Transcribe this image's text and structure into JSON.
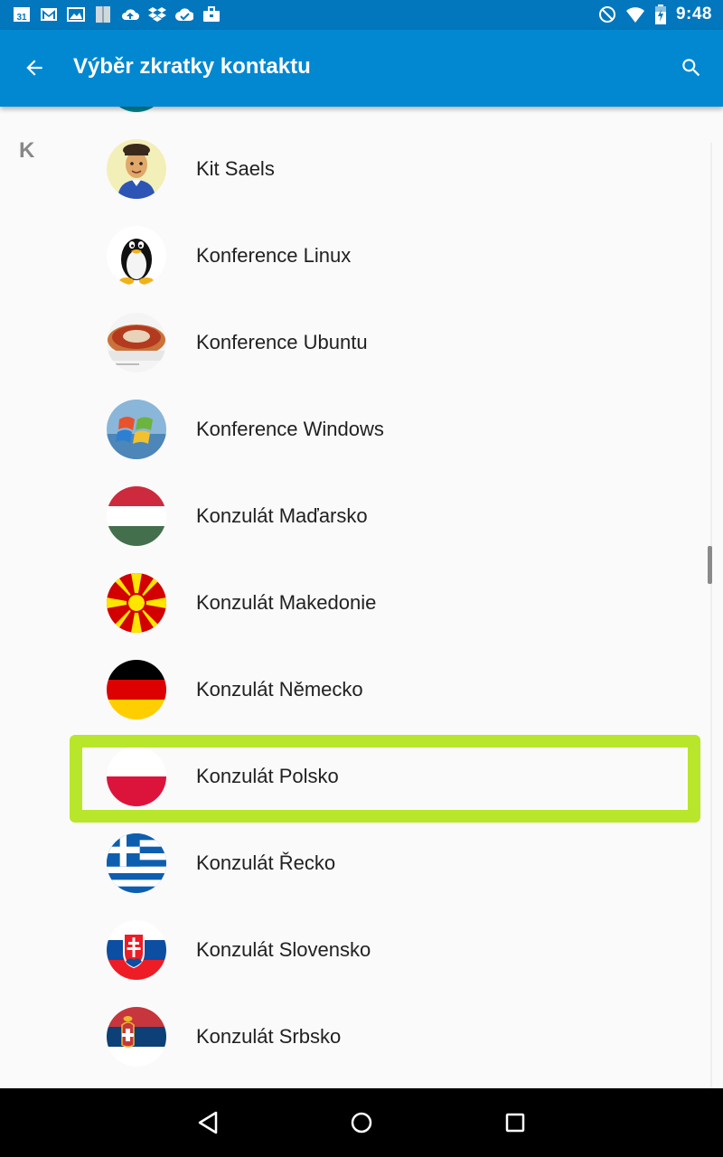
{
  "status_bar": {
    "time": "9:48",
    "calendar_day": "31",
    "left_icons": [
      "calendar-icon",
      "gmail-icon",
      "photos-icon",
      "book-icon",
      "cloud-upload-icon",
      "dropbox-icon",
      "check-cloud-icon",
      "briefcase-icon"
    ],
    "right_icons": [
      "do-not-disturb-icon",
      "wifi-icon",
      "battery-charging-icon"
    ]
  },
  "toolbar": {
    "title": "Výběr zkratky kontaktu",
    "back_icon": "arrow-back-icon",
    "search_icon": "search-icon",
    "color": "#0288d1"
  },
  "list": {
    "section_letter": "K",
    "contacts": [
      {
        "name": "Kit Saels",
        "avatar": "avatar-person"
      },
      {
        "name": "Konference Linux",
        "avatar": "avatar-tux"
      },
      {
        "name": "Konference Ubuntu",
        "avatar": "avatar-ubuntu"
      },
      {
        "name": "Konference Windows",
        "avatar": "avatar-windows"
      },
      {
        "name": "Konzulát Maďarsko",
        "avatar": "flag-hungary"
      },
      {
        "name": "Konzulát Makedonie",
        "avatar": "flag-macedonia"
      },
      {
        "name": "Konzulát Německo",
        "avatar": "flag-germany"
      },
      {
        "name": "Konzulát Polsko",
        "avatar": "flag-poland"
      },
      {
        "name": "Konzulát Řecko",
        "avatar": "flag-greece"
      },
      {
        "name": "Konzulát Slovensko",
        "avatar": "flag-slovakia"
      },
      {
        "name": "Konzulát Srbsko",
        "avatar": "flag-serbia"
      }
    ],
    "highlighted_index": 7,
    "highlight_color": "#b8e62a"
  },
  "nav_bar": {
    "buttons": [
      "back-triangle-icon",
      "home-circle-icon",
      "recents-square-icon"
    ]
  }
}
